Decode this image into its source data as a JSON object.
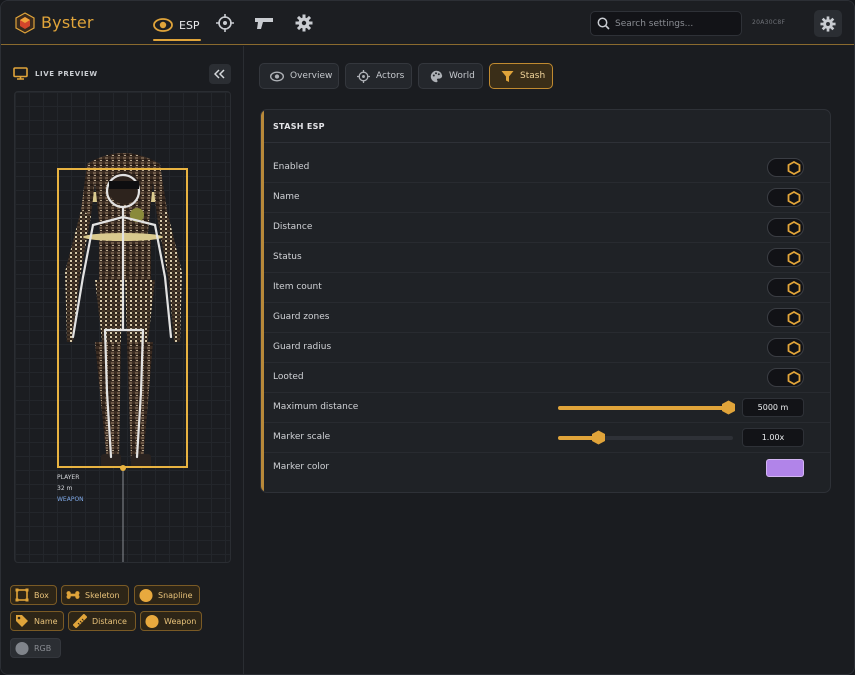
{
  "app": {
    "brand": "Byster",
    "code": "20A30C8F"
  },
  "nav": {
    "esp_label": "ESP",
    "tabs": [
      "eye-icon",
      "crosshair-icon",
      "gun-icon",
      "gear-icon"
    ]
  },
  "search": {
    "placeholder": "Search settings..."
  },
  "left": {
    "title": "LIVE PREVIEW",
    "player": {
      "name": "PLAYER",
      "distance": "32 m",
      "weapon": "WEAPON"
    },
    "chips": [
      {
        "label": "Box",
        "icon": "box-icon",
        "active": true
      },
      {
        "label": "Skeleton",
        "icon": "bone-icon",
        "active": true
      },
      {
        "label": "Snapline",
        "icon": "dot-icon",
        "active": true
      },
      {
        "label": "Name",
        "icon": "tag-icon",
        "active": true
      },
      {
        "label": "Distance",
        "icon": "ruler-icon",
        "active": true
      },
      {
        "label": "Weapon",
        "icon": "dot-icon",
        "active": true
      },
      {
        "label": "RGB",
        "icon": "dot-icon",
        "active": false
      }
    ]
  },
  "tabs": [
    {
      "label": "Overview",
      "icon": "eye-icon",
      "active": false
    },
    {
      "label": "Actors",
      "icon": "crosshair-icon",
      "active": false
    },
    {
      "label": "World",
      "icon": "palette-icon",
      "active": false
    },
    {
      "label": "Stash",
      "icon": "funnel-icon",
      "active": true
    }
  ],
  "card": {
    "title": "STASH ESP",
    "toggles": [
      {
        "label": "Enabled",
        "on": true
      },
      {
        "label": "Name",
        "on": true
      },
      {
        "label": "Distance",
        "on": true
      },
      {
        "label": "Status",
        "on": true
      },
      {
        "label": "Item count",
        "on": true
      },
      {
        "label": "Guard zones",
        "on": true
      },
      {
        "label": "Guard radius",
        "on": true
      },
      {
        "label": "Looted",
        "on": true
      }
    ],
    "sliders": [
      {
        "label": "Maximum distance",
        "value_text": "5000 m",
        "fraction": 0.97
      },
      {
        "label": "Marker scale",
        "value_text": "1.00x",
        "fraction": 0.23
      }
    ],
    "color": {
      "label": "Marker color",
      "value": "#b184e9"
    }
  },
  "colors": {
    "accent": "#e0a43a",
    "background": "#1a1c20"
  }
}
